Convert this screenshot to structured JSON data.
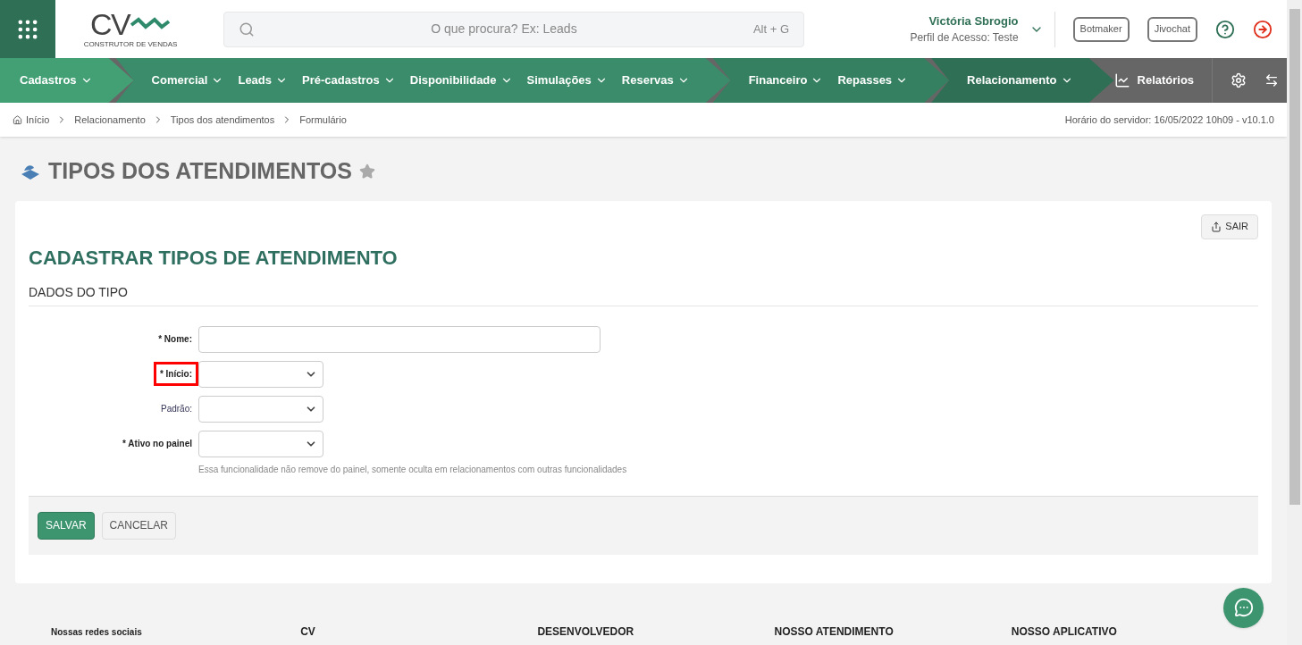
{
  "logo": {
    "mark": "CV",
    "tagline": "CONSTRUTOR DE VENDAS"
  },
  "search": {
    "placeholder": "O que procura? Ex: Leads",
    "shortcut": "Alt + G"
  },
  "user": {
    "name": "Victória Sbrogio",
    "profile": "Perfil de Acesso: Teste"
  },
  "header_buttons": [
    "Botmaker",
    "Jivochat"
  ],
  "nav_groups": [
    {
      "color": "#43a075",
      "items": [
        "Cadastros"
      ]
    },
    {
      "color": "#3b8c6a",
      "items": [
        "Comercial",
        "Leads",
        "Pré-cadastros",
        "Disponibilidade",
        "Simulações",
        "Reservas"
      ]
    },
    {
      "color": "#358060",
      "items": [
        "Financeiro",
        "Repasses"
      ]
    },
    {
      "color": "#2f6f55",
      "items": [
        "Relacionamento"
      ]
    }
  ],
  "reports": "Relatórios",
  "breadcrumb": [
    "Início",
    "Relacionamento",
    "Tipos dos atendimentos",
    "Formulário"
  ],
  "server_time": "Horário do servidor: 16/05/2022 10h09 - v10.1.0",
  "page_title": "TIPOS DOS ATENDIMENTOS",
  "exit_button": "SAIR",
  "form_title": "CADASTRAR TIPOS DE ATENDIMENTO",
  "section_title": "DADOS DO TIPO",
  "fields": [
    {
      "kind": "text",
      "label": "* Nome:",
      "required": true,
      "highlighted": false
    },
    {
      "kind": "select",
      "label": "* Início:",
      "required": true,
      "highlighted": true
    },
    {
      "kind": "select",
      "label": "Padrão:",
      "required": false,
      "highlighted": false
    },
    {
      "kind": "select",
      "label": "* Ativo no painel",
      "required": true,
      "highlighted": false,
      "help": "Essa funcionalidade não remove do painel, somente oculta em relacionamentos com outras funcionalidades"
    }
  ],
  "actions": [
    "SALVAR",
    "CANCELAR"
  ],
  "footer_columns": [
    "Nossas redes sociais",
    "CV",
    "DESENVOLVEDOR",
    "NOSSO ATENDIMENTO",
    "NOSSO APLICATIVO"
  ]
}
